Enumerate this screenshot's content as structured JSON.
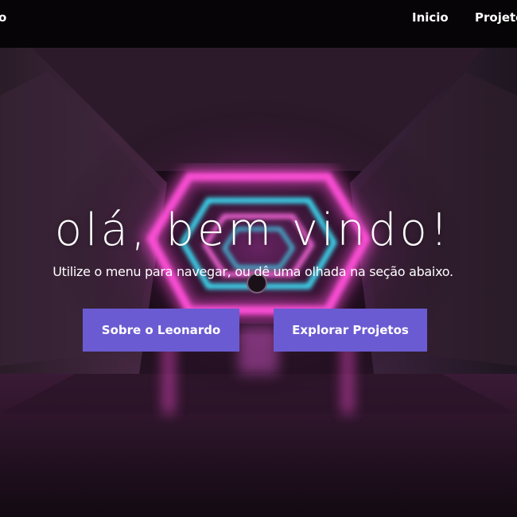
{
  "nav": {
    "brand": "o",
    "links": [
      {
        "label": "Inicio"
      },
      {
        "label": "Projetos"
      }
    ]
  },
  "hero": {
    "title": "olá, bem vindo!",
    "subtitle": "Utilize o menu para navegar, ou dê uma olhada na seção abaixo.",
    "buttons": [
      {
        "label": "Sobre o Leonardo"
      },
      {
        "label": "Explorar Projetos"
      }
    ]
  },
  "colors": {
    "button_bg": "#6b5bd2",
    "neon_pink": "#ff4fd8",
    "neon_cyan": "#3ee8ff",
    "background": "#0a0609",
    "text": "#ffffff"
  }
}
